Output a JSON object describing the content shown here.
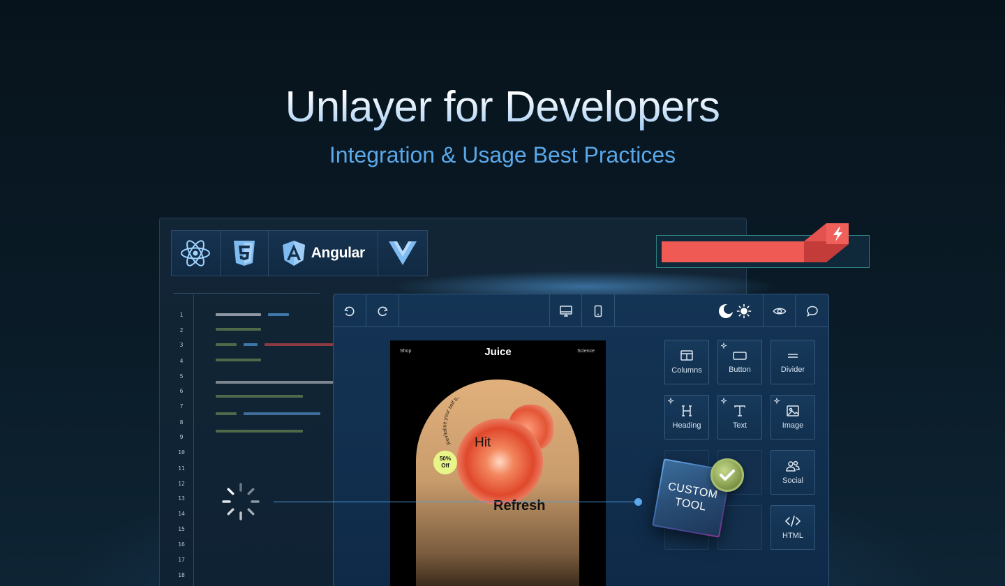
{
  "hero": {
    "title": "Unlayer for Developers",
    "subtitle": "Integration & Usage Best Practices"
  },
  "frameworks": {
    "items": [
      "react-icon",
      "html5-icon",
      "angular-icon",
      "vue-icon"
    ],
    "angular_label": "Angular"
  },
  "code": {
    "line_numbers": [
      "1",
      "2",
      "3",
      "4",
      "5",
      "6",
      "7",
      "8",
      "9",
      "10",
      "11",
      "12",
      "13",
      "14",
      "15",
      "16",
      "17",
      "18"
    ]
  },
  "editor": {
    "toolbar_icons": [
      "undo-icon",
      "redo-icon",
      "desktop-icon",
      "mobile-icon",
      "dark-mode-icon",
      "light-mode-icon",
      "preview-icon",
      "comment-icon"
    ],
    "email": {
      "nav_left": "Shop",
      "logo": "Juice",
      "nav_right": "Science",
      "arc_text": "Revitalise your self this season",
      "headline_top": "Hit",
      "headline_bottom": "Refresh",
      "badge_line1": "50%",
      "badge_line2": "Off"
    },
    "tools": {
      "columns": "Columns",
      "button": "Button",
      "divider": "Divider",
      "heading": "Heading",
      "text": "Text",
      "image": "Image",
      "social": "Social",
      "html": "HTML"
    },
    "custom_tool": {
      "line1": "CUSTOM",
      "line2": "TOOL"
    }
  },
  "colors": {
    "accent": "#5aa8ea",
    "red": "#f05a55",
    "check_green": "#8da455"
  }
}
